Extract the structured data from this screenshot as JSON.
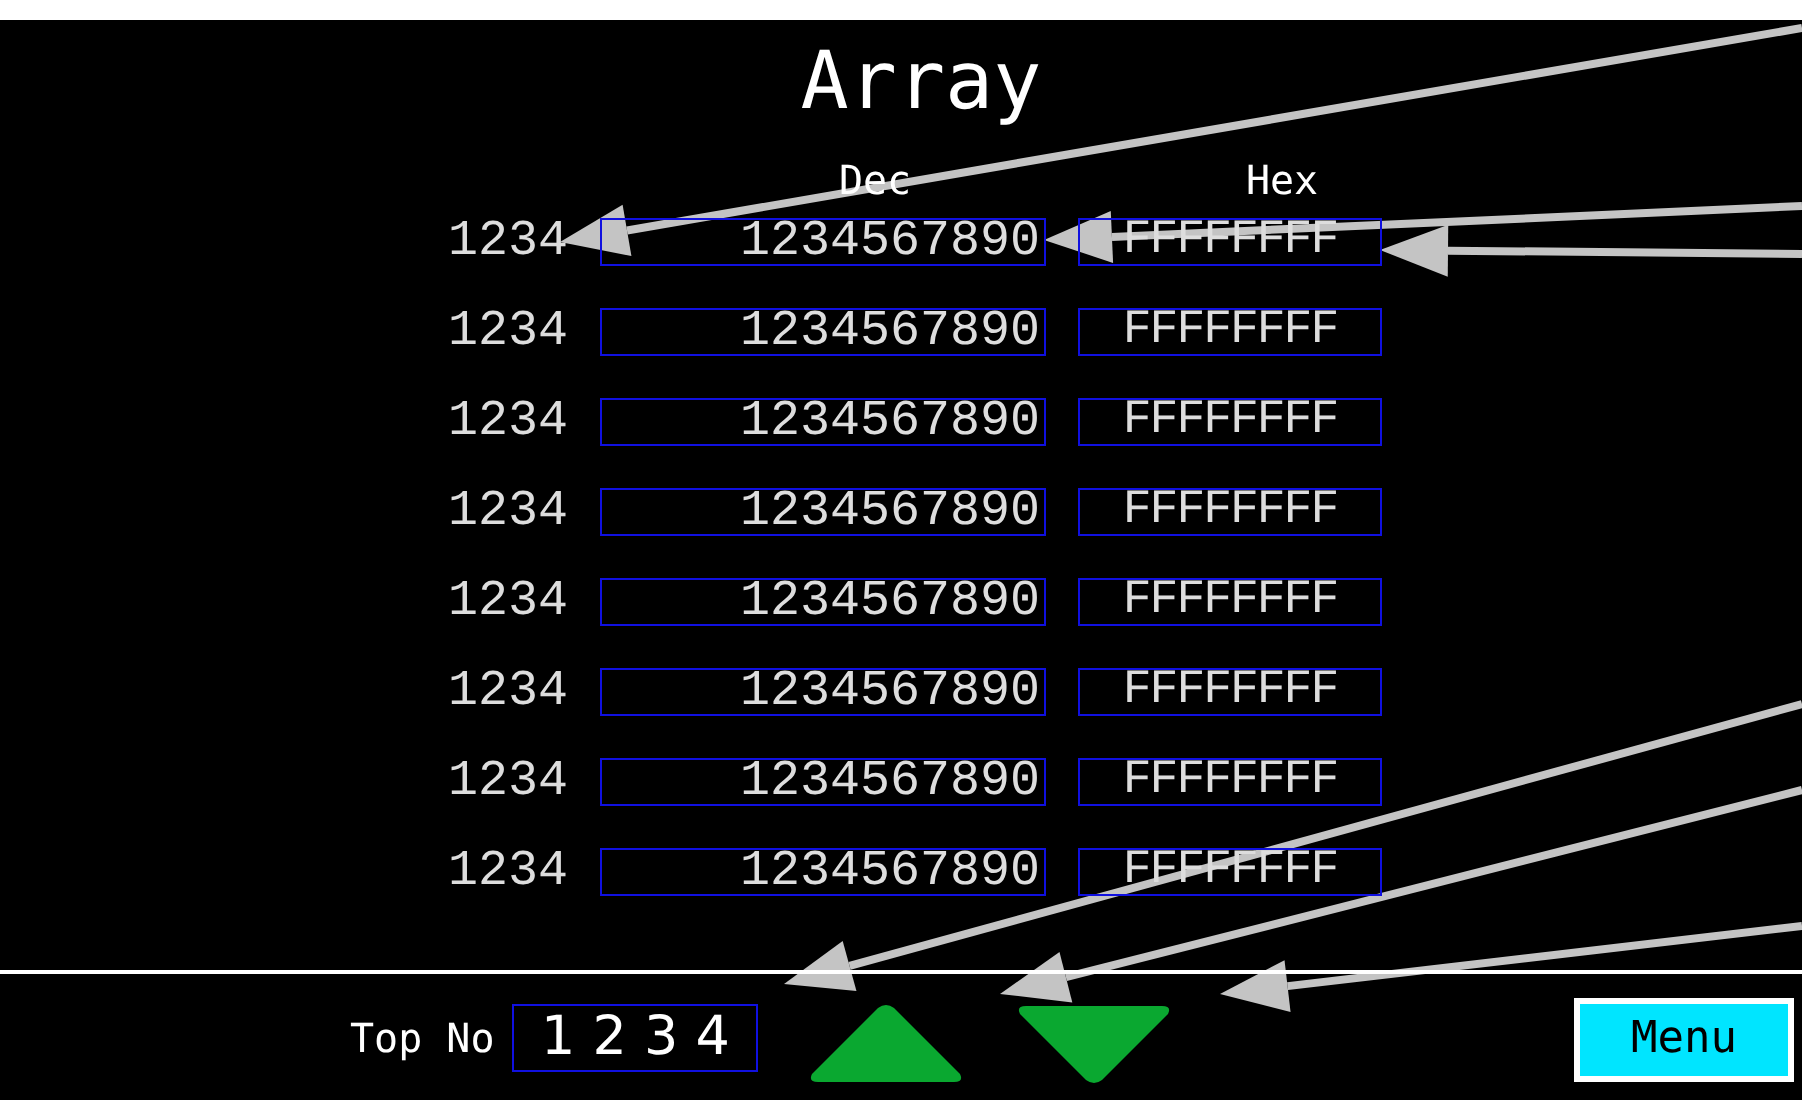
{
  "title": "Array",
  "columns": [
    "Dec",
    "Hex"
  ],
  "rows": [
    {
      "index": "1234",
      "dec": "1234567890",
      "hex": "FFFFFFFF"
    },
    {
      "index": "1234",
      "dec": "1234567890",
      "hex": "FFFFFFFF"
    },
    {
      "index": "1234",
      "dec": "1234567890",
      "hex": "FFFFFFFF"
    },
    {
      "index": "1234",
      "dec": "1234567890",
      "hex": "FFFFFFFF"
    },
    {
      "index": "1234",
      "dec": "1234567890",
      "hex": "FFFFFFFF"
    },
    {
      "index": "1234",
      "dec": "1234567890",
      "hex": "FFFFFFFF"
    },
    {
      "index": "1234",
      "dec": "1234567890",
      "hex": "FFFFFFFF"
    },
    {
      "index": "1234",
      "dec": "1234567890",
      "hex": "FFFFFFFF"
    }
  ],
  "footer": {
    "top_no_label": "Top No",
    "top_no_value": "1 2 3 4",
    "menu_button": "Menu"
  }
}
